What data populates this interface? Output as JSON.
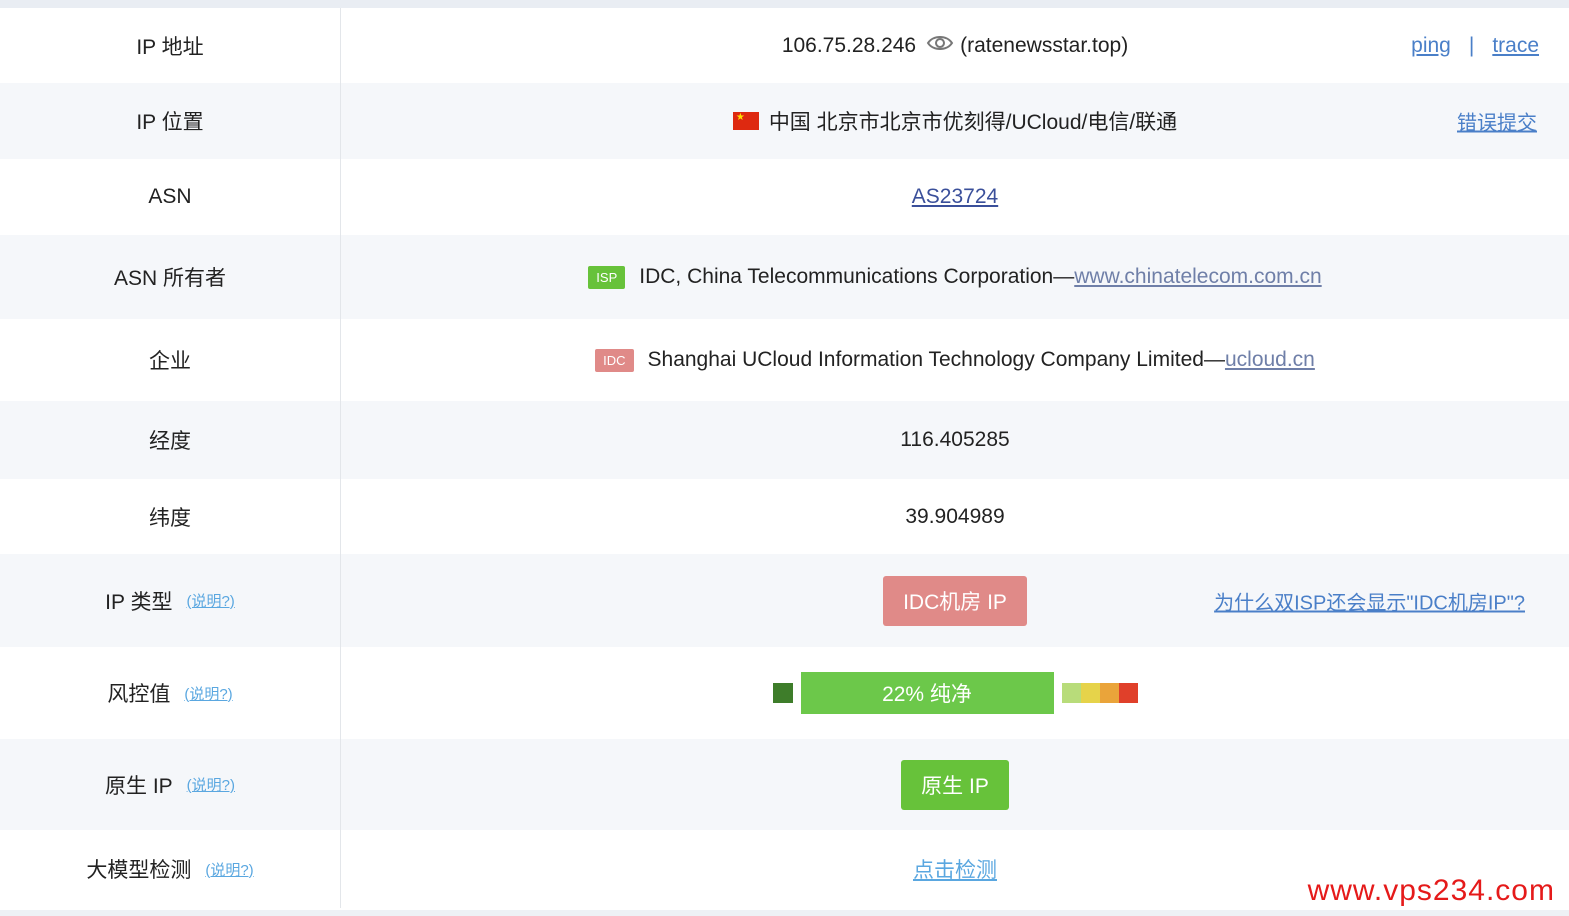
{
  "rows": [
    {
      "label": "IP 地址",
      "ip": "106.75.28.246",
      "host": "(ratenewsstar.top)",
      "actions": [
        "ping",
        "|",
        "trace"
      ]
    },
    {
      "label": "IP 位置",
      "location": "中国 北京市北京市优刻得/UCloud/电信/联通",
      "report": "错误提交"
    },
    {
      "label": "ASN",
      "asn": "AS23724"
    },
    {
      "label": "ASN 所有者",
      "tag": "ISP",
      "owner": "IDC, China Telecommunications Corporation—",
      "url": "www.chinatelecom.com.cn"
    },
    {
      "label": "企业",
      "tag": "IDC",
      "company": "Shanghai UCloud Information Technology Company Limited—",
      "url": "ucloud.cn"
    },
    {
      "label": "经度",
      "value": "116.405285"
    },
    {
      "label": "纬度",
      "value": "39.904989"
    },
    {
      "label": "IP 类型",
      "help": "(说明?)",
      "badge": "IDC机房 IP",
      "note": "为什么双ISP还会显示\"IDC机房IP\"?"
    },
    {
      "label": "风控值",
      "help": "(说明?)",
      "score_text": "22%  纯净",
      "score_percent": 22
    },
    {
      "label": "原生 IP",
      "help": "(说明?)",
      "badge": "原生 IP"
    },
    {
      "label": "大模型检测",
      "help": "(说明?)",
      "link": "点击检测"
    }
  ],
  "risk_scale_colors": [
    "#b8dc7a",
    "#e6d34a",
    "#eaa43a",
    "#e0402a"
  ],
  "risk_low_color": "#3e7d2a",
  "watermark": "www.vps234.com"
}
